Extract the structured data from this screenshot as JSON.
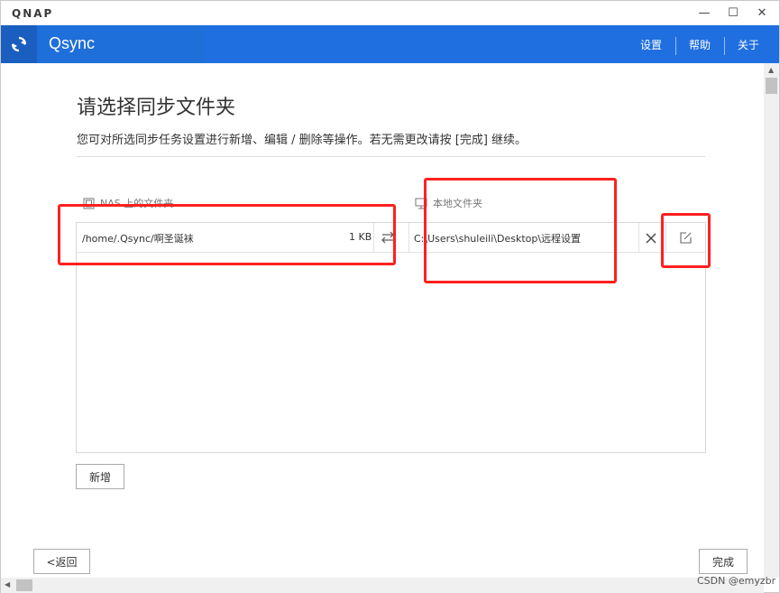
{
  "window": {
    "brand": "QNAP",
    "controls": {
      "minimize": "—",
      "maximize": "☐",
      "close": "✕"
    }
  },
  "app": {
    "name": "Qsync",
    "nav": {
      "settings": "设置",
      "help": "帮助",
      "about": "关于"
    }
  },
  "page": {
    "heading": "请选择同步文件夹",
    "subtitle": "您可对所选同步任务设置进行新增、编辑 / 删除等操作。若无需更改请按 [完成] 继续。"
  },
  "table": {
    "nas_header": "NAS 上的文件夹",
    "local_header": "本地文件夹",
    "rows": [
      {
        "nas_path": "/home/.Qsync/啊圣诞袜",
        "size": "1 KB",
        "local_path": "C:\\Users\\shuleili\\Desktop\\远程设置"
      }
    ]
  },
  "buttons": {
    "add": "新增",
    "back": "<返回",
    "finish": "完成"
  },
  "watermark": "CSDN @emyzbr",
  "colors": {
    "accent": "#1e6fd9",
    "annotation": "#ff2020"
  }
}
